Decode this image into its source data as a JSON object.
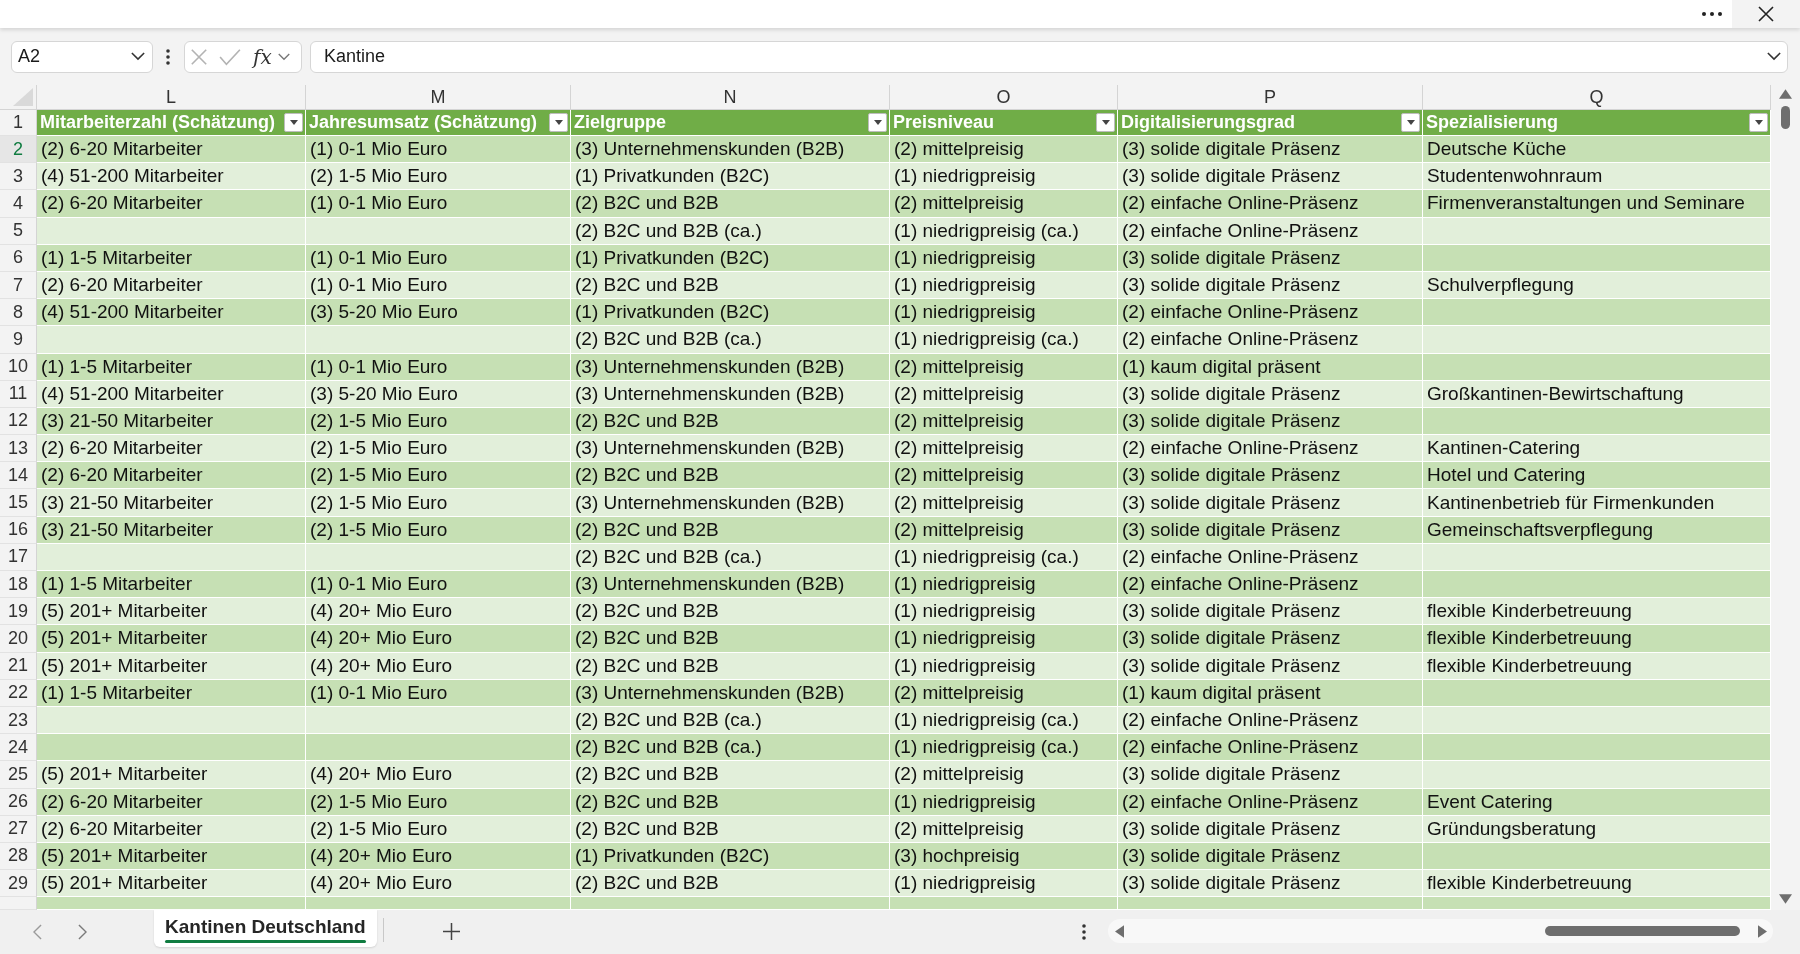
{
  "formula_bar": {
    "name_box": "A2",
    "function_label": "fx",
    "formula": "Kantine"
  },
  "sheet": {
    "columns": [
      {
        "letter": "L",
        "title": "Mitarbeiterzahl (Schätzung)"
      },
      {
        "letter": "M",
        "title": "Jahresumsatz (Schätzung)"
      },
      {
        "letter": "N",
        "title": "Zielgruppe"
      },
      {
        "letter": "O",
        "title": "Preisniveau"
      },
      {
        "letter": "P",
        "title": "Digitalisierungsgrad"
      },
      {
        "letter": "Q",
        "title": "Spezialisierung"
      }
    ],
    "header_row_number": "1",
    "rows": [
      {
        "number": "2",
        "selected": true,
        "cells": [
          "(2) 6-20 Mitarbeiter",
          "(1) 0-1 Mio Euro",
          "(3) Unternehmenskunden (B2B)",
          "(2) mittelpreisig",
          "(3) solide digitale Präsenz",
          "Deutsche Küche"
        ]
      },
      {
        "number": "3",
        "selected": false,
        "cells": [
          "(4) 51-200 Mitarbeiter",
          "(2) 1-5 Mio Euro",
          "(1) Privatkunden (B2C)",
          "(1) niedrigpreisig",
          "(3) solide digitale Präsenz",
          "Studentenwohnraum"
        ]
      },
      {
        "number": "4",
        "selected": false,
        "cells": [
          "(2) 6-20 Mitarbeiter",
          "(1) 0-1 Mio Euro",
          "(2) B2C und B2B",
          "(2) mittelpreisig",
          "(2) einfache Online-Präsenz",
          "Firmenveranstaltungen und Seminare"
        ]
      },
      {
        "number": "5",
        "selected": false,
        "cells": [
          null,
          null,
          "(2) B2C und B2B (ca.)",
          "(1) niedrigpreisig (ca.)",
          "(2) einfache Online-Präsenz",
          null
        ]
      },
      {
        "number": "6",
        "selected": false,
        "cells": [
          "(1) 1-5 Mitarbeiter",
          "(1) 0-1 Mio Euro",
          "(1) Privatkunden (B2C)",
          "(1) niedrigpreisig",
          "(3) solide digitale Präsenz",
          null
        ]
      },
      {
        "number": "7",
        "selected": false,
        "cells": [
          "(2) 6-20 Mitarbeiter",
          "(1) 0-1 Mio Euro",
          "(2) B2C und B2B",
          "(1) niedrigpreisig",
          "(3) solide digitale Präsenz",
          "Schulverpflegung"
        ]
      },
      {
        "number": "8",
        "selected": false,
        "cells": [
          "(4) 51-200 Mitarbeiter",
          "(3) 5-20 Mio Euro",
          "(1) Privatkunden (B2C)",
          "(1) niedrigpreisig",
          "(2) einfache Online-Präsenz",
          null
        ]
      },
      {
        "number": "9",
        "selected": false,
        "cells": [
          null,
          null,
          "(2) B2C und B2B (ca.)",
          "(1) niedrigpreisig (ca.)",
          "(2) einfache Online-Präsenz",
          null
        ]
      },
      {
        "number": "10",
        "selected": false,
        "cells": [
          "(1) 1-5 Mitarbeiter",
          "(1) 0-1 Mio Euro",
          "(3) Unternehmenskunden (B2B)",
          "(2) mittelpreisig",
          "(1) kaum digital präsent",
          null
        ]
      },
      {
        "number": "11",
        "selected": false,
        "cells": [
          "(4) 51-200 Mitarbeiter",
          "(3) 5-20 Mio Euro",
          "(3) Unternehmenskunden (B2B)",
          "(2) mittelpreisig",
          "(3) solide digitale Präsenz",
          "Großkantinen-Bewirtschaftung"
        ]
      },
      {
        "number": "12",
        "selected": false,
        "cells": [
          "(3) 21-50 Mitarbeiter",
          "(2) 1-5 Mio Euro",
          "(2) B2C und B2B",
          "(2) mittelpreisig",
          "(3) solide digitale Präsenz",
          null
        ]
      },
      {
        "number": "13",
        "selected": false,
        "cells": [
          "(2) 6-20 Mitarbeiter",
          "(2) 1-5 Mio Euro",
          "(3) Unternehmenskunden (B2B)",
          "(2) mittelpreisig",
          "(2) einfache Online-Präsenz",
          "Kantinen-Catering"
        ]
      },
      {
        "number": "14",
        "selected": false,
        "cells": [
          "(2) 6-20 Mitarbeiter",
          "(2) 1-5 Mio Euro",
          "(2) B2C und B2B",
          "(2) mittelpreisig",
          "(3) solide digitale Präsenz",
          "Hotel und Catering"
        ]
      },
      {
        "number": "15",
        "selected": false,
        "cells": [
          "(3) 21-50 Mitarbeiter",
          "(2) 1-5 Mio Euro",
          "(3) Unternehmenskunden (B2B)",
          "(2) mittelpreisig",
          "(3) solide digitale Präsenz",
          "Kantinenbetrieb für Firmenkunden"
        ]
      },
      {
        "number": "16",
        "selected": false,
        "cells": [
          "(3) 21-50 Mitarbeiter",
          "(2) 1-5 Mio Euro",
          "(2) B2C und B2B",
          "(2) mittelpreisig",
          "(3) solide digitale Präsenz",
          "Gemeinschaftsverpflegung"
        ]
      },
      {
        "number": "17",
        "selected": false,
        "cells": [
          null,
          null,
          "(2) B2C und B2B (ca.)",
          "(1) niedrigpreisig (ca.)",
          "(2) einfache Online-Präsenz",
          null
        ]
      },
      {
        "number": "18",
        "selected": false,
        "cells": [
          "(1) 1-5 Mitarbeiter",
          "(1) 0-1 Mio Euro",
          "(3) Unternehmenskunden (B2B)",
          "(1) niedrigpreisig",
          "(2) einfache Online-Präsenz",
          null
        ]
      },
      {
        "number": "19",
        "selected": false,
        "cells": [
          "(5) 201+ Mitarbeiter",
          "(4) 20+ Mio Euro",
          "(2) B2C und B2B",
          "(1) niedrigpreisig",
          "(3) solide digitale Präsenz",
          "flexible Kinderbetreuung"
        ]
      },
      {
        "number": "20",
        "selected": false,
        "cells": [
          "(5) 201+ Mitarbeiter",
          "(4) 20+ Mio Euro",
          "(2) B2C und B2B",
          "(1) niedrigpreisig",
          "(3) solide digitale Präsenz",
          "flexible Kinderbetreuung"
        ]
      },
      {
        "number": "21",
        "selected": false,
        "cells": [
          "(5) 201+ Mitarbeiter",
          "(4) 20+ Mio Euro",
          "(2) B2C und B2B",
          "(1) niedrigpreisig",
          "(3) solide digitale Präsenz",
          "flexible Kinderbetreuung"
        ]
      },
      {
        "number": "22",
        "selected": false,
        "cells": [
          "(1) 1-5 Mitarbeiter",
          "(1) 0-1 Mio Euro",
          "(3) Unternehmenskunden (B2B)",
          "(2) mittelpreisig",
          "(1) kaum digital präsent",
          null
        ]
      },
      {
        "number": "23",
        "selected": false,
        "cells": [
          null,
          null,
          "(2) B2C und B2B (ca.)",
          "(1) niedrigpreisig (ca.)",
          "(2) einfache Online-Präsenz",
          null
        ]
      },
      {
        "number": "24",
        "selected": false,
        "cells": [
          null,
          null,
          "(2) B2C und B2B (ca.)",
          "(1) niedrigpreisig (ca.)",
          "(2) einfache Online-Präsenz",
          null
        ]
      },
      {
        "number": "25",
        "selected": false,
        "cells": [
          "(5) 201+ Mitarbeiter",
          "(4) 20+ Mio Euro",
          "(2) B2C und B2B",
          "(2) mittelpreisig",
          "(3) solide digitale Präsenz",
          null
        ]
      },
      {
        "number": "26",
        "selected": false,
        "cells": [
          "(2) 6-20 Mitarbeiter",
          "(2) 1-5 Mio Euro",
          "(2) B2C und B2B",
          "(1) niedrigpreisig",
          "(2) einfache Online-Präsenz",
          "Event Catering"
        ]
      },
      {
        "number": "27",
        "selected": false,
        "cells": [
          "(2) 6-20 Mitarbeiter",
          "(2) 1-5 Mio Euro",
          "(2) B2C und B2B",
          "(2) mittelpreisig",
          "(3) solide digitale Präsenz",
          "Gründungsberatung"
        ]
      },
      {
        "number": "28",
        "selected": false,
        "cells": [
          "(5) 201+ Mitarbeiter",
          "(4) 20+ Mio Euro",
          "(1) Privatkunden (B2C)",
          "(3) hochpreisig",
          "(3) solide digitale Präsenz",
          null
        ]
      },
      {
        "number": "29",
        "selected": false,
        "cells": [
          "(5) 201+ Mitarbeiter",
          "(4) 20+ Mio Euro",
          "(2) B2C und B2B",
          "(1) niedrigpreisig",
          "(3) solide digitale Präsenz",
          "flexible Kinderbetreuung"
        ]
      }
    ]
  },
  "sheet_tabs": [
    {
      "label": "Kantinen Deutschland",
      "selected": true
    }
  ]
}
